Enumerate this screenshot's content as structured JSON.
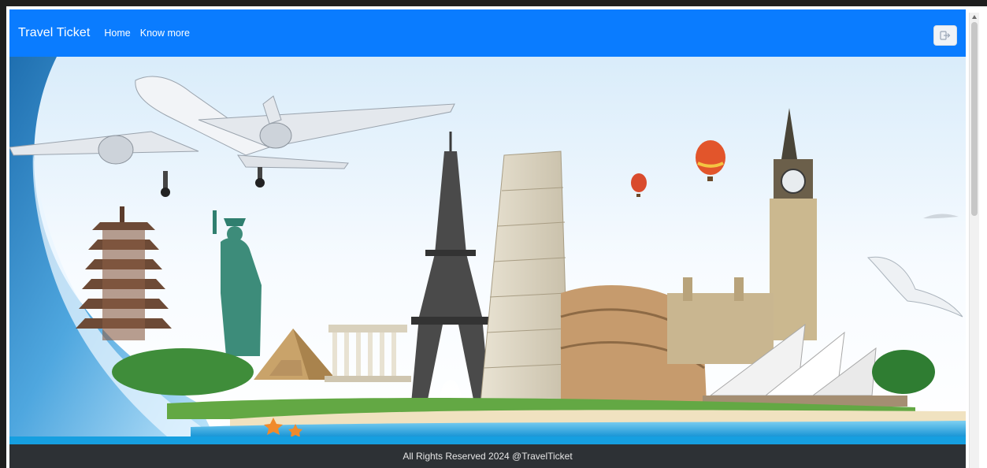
{
  "navbar": {
    "brand": "Travel Ticket",
    "links": [
      "Home",
      "Know more"
    ],
    "logout_icon": "logout-icon",
    "color": "#0a7cff"
  },
  "hero": {
    "image": "travel-landmarks-collage",
    "band_color": "#169fe0"
  },
  "footer": {
    "text": "All Rights Reserved 2024 @TravelTicket",
    "background": "#2d3135"
  }
}
